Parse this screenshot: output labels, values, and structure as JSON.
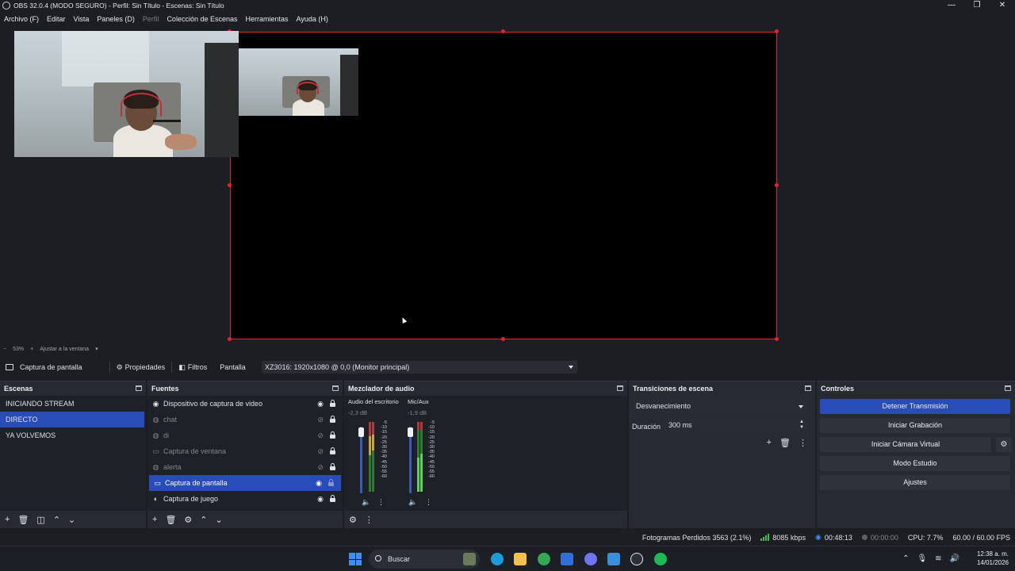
{
  "window": {
    "title": "OBS 32.0.4 (MODO SEGURO) - Perfil: Sin Título - Escenas: Sin Título",
    "minimize": "—",
    "maximize": "❐",
    "close": "✕"
  },
  "menu": {
    "archivo": "Archivo (F)",
    "editar": "Editar",
    "vista": "Vista",
    "paneles": "Paneles (D)",
    "perfil": "Perfil",
    "coleccion": "Colección de Escenas",
    "herramientas": "Herramientas",
    "ayuda": "Ayuda (H)"
  },
  "zoom": {
    "minus": "−",
    "percent": "53%",
    "plus": "+",
    "fit": "Ajustar a la ventana"
  },
  "source_toolbar": {
    "selected_source": "Captura de pantalla",
    "properties": "Propiedades",
    "filters": "Filtros",
    "display_label": "Pantalla",
    "display_value": "XZ3016: 1920x1080 @ 0,0 (Monitor principal)"
  },
  "scenes": {
    "title": "Escenas",
    "items": [
      "INICIANDO STREAM",
      "DIRECTO",
      "YA VOLVEMOS"
    ]
  },
  "sources": {
    "title": "Fuentes",
    "items": [
      {
        "label": "Dispositivo de captura de video",
        "icon": "camera-icon",
        "visible": true
      },
      {
        "label": "chat",
        "icon": "browser-icon",
        "visible": false
      },
      {
        "label": "di",
        "icon": "browser-icon",
        "visible": false
      },
      {
        "label": "Captura de ventana",
        "icon": "window-icon",
        "visible": false
      },
      {
        "label": "alerta",
        "icon": "browser-icon",
        "visible": false
      },
      {
        "label": "Captura de pantalla",
        "icon": "monitor-icon",
        "visible": true
      },
      {
        "label": "Captura de juego",
        "icon": "gamepad-icon",
        "visible": true
      }
    ]
  },
  "mixer": {
    "title": "Mezclador de audio",
    "channels": [
      {
        "name": "Audio del escritorio",
        "db": "-2,3 dB",
        "level": 0.9
      },
      {
        "name": "Mic/Aux",
        "db": "-1,9 dB",
        "level": 0.55
      }
    ],
    "scale": [
      "-5",
      "-10",
      "-15",
      "-20",
      "-25",
      "-30",
      "-35",
      "-40",
      "-45",
      "-50",
      "-55",
      "-60"
    ]
  },
  "transitions": {
    "title": "Transiciones de escena",
    "selected": "Desvanecimiento",
    "duration_label": "Duración",
    "duration_value": "300 ms"
  },
  "controls": {
    "title": "Controles",
    "stop_stream": "Detener Transmisión",
    "start_recording": "Iniciar Grabación",
    "start_virtual_cam": "Iniciar Cámara Virtual",
    "studio_mode": "Modo Estudio",
    "settings": "Ajustes"
  },
  "status": {
    "dropped_frames": "Fotogramas Perdidos 3563 (2.1%)",
    "bitrate": "8085 kbps",
    "stream_time": "00:48:13",
    "record_time": "00:00:00",
    "cpu": "CPU: 7.7%",
    "fps": "60.00 / 60.00 FPS"
  },
  "taskbar": {
    "search": "Buscar",
    "time": "12:38 a. m.",
    "date": "14/01/2026"
  },
  "colors": {
    "accent": "#284cb8",
    "selection_border": "#e0242e",
    "panel": "#272a33",
    "background": "#1d1e23"
  }
}
